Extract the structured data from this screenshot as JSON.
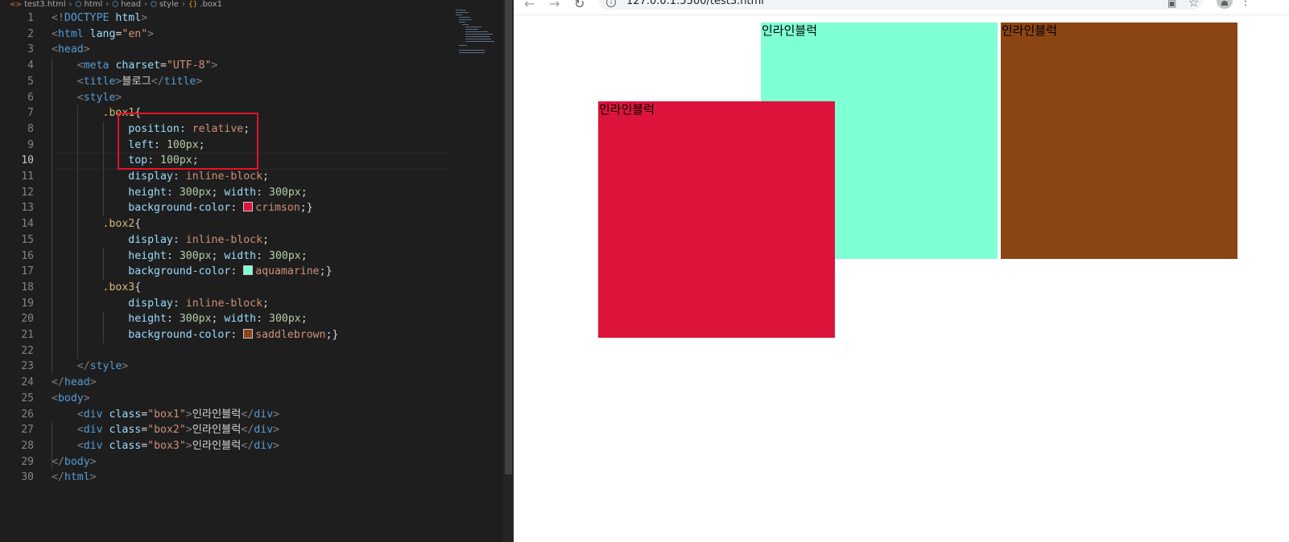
{
  "editor": {
    "breadcrumb": [
      "test3.html",
      "html",
      "head",
      "style",
      ".box1"
    ],
    "lines": [
      {
        "n": "1",
        "tokens": [
          [
            "punc",
            "<!"
          ],
          [
            "tag",
            "DOCTYPE"
          ],
          [
            "txt",
            " "
          ],
          [
            "attr",
            "html"
          ],
          [
            "punc",
            ">"
          ]
        ]
      },
      {
        "n": "2",
        "tokens": [
          [
            "punc",
            "<"
          ],
          [
            "tag",
            "html"
          ],
          [
            "txt",
            " "
          ],
          [
            "attr",
            "lang"
          ],
          [
            "txt",
            "="
          ],
          [
            "str",
            "\"en\""
          ],
          [
            "punc",
            ">"
          ]
        ]
      },
      {
        "n": "3",
        "tokens": [
          [
            "punc",
            "<"
          ],
          [
            "tag",
            "head"
          ],
          [
            "punc",
            ">"
          ]
        ]
      },
      {
        "n": "4",
        "tokens": [
          [
            "txt",
            "    "
          ],
          [
            "punc",
            "<"
          ],
          [
            "tag",
            "meta"
          ],
          [
            "txt",
            " "
          ],
          [
            "attr",
            "charset"
          ],
          [
            "txt",
            "="
          ],
          [
            "str",
            "\"UTF-8\""
          ],
          [
            "punc",
            ">"
          ]
        ]
      },
      {
        "n": "5",
        "tokens": [
          [
            "txt",
            "    "
          ],
          [
            "punc",
            "<"
          ],
          [
            "tag",
            "title"
          ],
          [
            "punc",
            ">"
          ],
          [
            "txt",
            "블로그"
          ],
          [
            "punc",
            "</"
          ],
          [
            "tag",
            "title"
          ],
          [
            "punc",
            ">"
          ]
        ]
      },
      {
        "n": "6",
        "tokens": [
          [
            "txt",
            "    "
          ],
          [
            "punc",
            "<"
          ],
          [
            "tag",
            "style"
          ],
          [
            "punc",
            ">"
          ]
        ]
      },
      {
        "n": "7",
        "tokens": [
          [
            "txt",
            "        "
          ],
          [
            "sel",
            ".box1"
          ],
          [
            "br",
            "{"
          ]
        ]
      },
      {
        "n": "8",
        "tokens": [
          [
            "txt",
            "            "
          ],
          [
            "prop",
            "position"
          ],
          [
            "txt",
            ": "
          ],
          [
            "val",
            "relative"
          ],
          [
            "txt",
            ";"
          ]
        ]
      },
      {
        "n": "9",
        "tokens": [
          [
            "txt",
            "            "
          ],
          [
            "prop",
            "left"
          ],
          [
            "txt",
            ": "
          ],
          [
            "num",
            "100px"
          ],
          [
            "txt",
            ";"
          ]
        ]
      },
      {
        "n": "10",
        "tokens": [
          [
            "txt",
            "            "
          ],
          [
            "prop",
            "top"
          ],
          [
            "txt",
            ": "
          ],
          [
            "num",
            "100px"
          ],
          [
            "txt",
            ";"
          ]
        ]
      },
      {
        "n": "11",
        "tokens": [
          [
            "txt",
            "            "
          ],
          [
            "prop",
            "display"
          ],
          [
            "txt",
            ": "
          ],
          [
            "val",
            "inline-block"
          ],
          [
            "txt",
            ";"
          ]
        ]
      },
      {
        "n": "12",
        "tokens": [
          [
            "txt",
            "            "
          ],
          [
            "prop",
            "height"
          ],
          [
            "txt",
            ": "
          ],
          [
            "num",
            "300px"
          ],
          [
            "txt",
            "; "
          ],
          [
            "prop",
            "width"
          ],
          [
            "txt",
            ": "
          ],
          [
            "num",
            "300px"
          ],
          [
            "txt",
            ";"
          ]
        ]
      },
      {
        "n": "13",
        "tokens": [
          [
            "txt",
            "            "
          ],
          [
            "prop",
            "background-color"
          ],
          [
            "txt",
            ": "
          ],
          [
            "swatch",
            "#dc143c"
          ],
          [
            "val",
            "crimson"
          ],
          [
            "txt",
            ";"
          ],
          [
            "br",
            "}"
          ]
        ]
      },
      {
        "n": "14",
        "tokens": [
          [
            "txt",
            "        "
          ],
          [
            "sel",
            ".box2"
          ],
          [
            "br",
            "{"
          ]
        ]
      },
      {
        "n": "15",
        "tokens": [
          [
            "txt",
            "            "
          ],
          [
            "prop",
            "display"
          ],
          [
            "txt",
            ": "
          ],
          [
            "val",
            "inline-block"
          ],
          [
            "txt",
            ";"
          ]
        ]
      },
      {
        "n": "16",
        "tokens": [
          [
            "txt",
            "            "
          ],
          [
            "prop",
            "height"
          ],
          [
            "txt",
            ": "
          ],
          [
            "num",
            "300px"
          ],
          [
            "txt",
            "; "
          ],
          [
            "prop",
            "width"
          ],
          [
            "txt",
            ": "
          ],
          [
            "num",
            "300px"
          ],
          [
            "txt",
            ";"
          ]
        ]
      },
      {
        "n": "17",
        "tokens": [
          [
            "txt",
            "            "
          ],
          [
            "prop",
            "background-color"
          ],
          [
            "txt",
            ": "
          ],
          [
            "swatch",
            "#7fffd4"
          ],
          [
            "val",
            "aquamarine"
          ],
          [
            "txt",
            ";"
          ],
          [
            "br",
            "}"
          ]
        ]
      },
      {
        "n": "18",
        "tokens": [
          [
            "txt",
            "        "
          ],
          [
            "sel",
            ".box3"
          ],
          [
            "br",
            "{"
          ]
        ]
      },
      {
        "n": "19",
        "tokens": [
          [
            "txt",
            "            "
          ],
          [
            "prop",
            "display"
          ],
          [
            "txt",
            ": "
          ],
          [
            "val",
            "inline-block"
          ],
          [
            "txt",
            ";"
          ]
        ]
      },
      {
        "n": "20",
        "tokens": [
          [
            "txt",
            "            "
          ],
          [
            "prop",
            "height"
          ],
          [
            "txt",
            ": "
          ],
          [
            "num",
            "300px"
          ],
          [
            "txt",
            "; "
          ],
          [
            "prop",
            "width"
          ],
          [
            "txt",
            ": "
          ],
          [
            "num",
            "300px"
          ],
          [
            "txt",
            ";"
          ]
        ]
      },
      {
        "n": "21",
        "tokens": [
          [
            "txt",
            "            "
          ],
          [
            "prop",
            "background-color"
          ],
          [
            "txt",
            ": "
          ],
          [
            "swatch",
            "#8b4513"
          ],
          [
            "val",
            "saddlebrown"
          ],
          [
            "txt",
            ";"
          ],
          [
            "br",
            "}"
          ]
        ]
      },
      {
        "n": "22",
        "tokens": []
      },
      {
        "n": "23",
        "tokens": [
          [
            "txt",
            "    "
          ],
          [
            "punc",
            "</"
          ],
          [
            "tag",
            "style"
          ],
          [
            "punc",
            ">"
          ]
        ]
      },
      {
        "n": "24",
        "tokens": [
          [
            "punc",
            "</"
          ],
          [
            "tag",
            "head"
          ],
          [
            "punc",
            ">"
          ]
        ]
      },
      {
        "n": "25",
        "tokens": [
          [
            "punc",
            "<"
          ],
          [
            "tag",
            "body"
          ],
          [
            "punc",
            ">"
          ]
        ]
      },
      {
        "n": "26",
        "tokens": [
          [
            "txt",
            "    "
          ],
          [
            "punc",
            "<"
          ],
          [
            "tag",
            "div"
          ],
          [
            "txt",
            " "
          ],
          [
            "attr",
            "class"
          ],
          [
            "txt",
            "="
          ],
          [
            "str",
            "\"box1\""
          ],
          [
            "punc",
            ">"
          ],
          [
            "txt",
            "인라인블럭"
          ],
          [
            "punc",
            "</"
          ],
          [
            "tag",
            "div"
          ],
          [
            "punc",
            ">"
          ]
        ]
      },
      {
        "n": "27",
        "tokens": [
          [
            "txt",
            "    "
          ],
          [
            "punc",
            "<"
          ],
          [
            "tag",
            "div"
          ],
          [
            "txt",
            " "
          ],
          [
            "attr",
            "class"
          ],
          [
            "txt",
            "="
          ],
          [
            "str",
            "\"box2\""
          ],
          [
            "punc",
            ">"
          ],
          [
            "txt",
            "인라인블럭"
          ],
          [
            "punc",
            "</"
          ],
          [
            "tag",
            "div"
          ],
          [
            "punc",
            ">"
          ]
        ]
      },
      {
        "n": "28",
        "tokens": [
          [
            "txt",
            "    "
          ],
          [
            "punc",
            "<"
          ],
          [
            "tag",
            "div"
          ],
          [
            "txt",
            " "
          ],
          [
            "attr",
            "class"
          ],
          [
            "txt",
            "="
          ],
          [
            "str",
            "\"box3\""
          ],
          [
            "punc",
            ">"
          ],
          [
            "txt",
            "인라인블럭"
          ],
          [
            "punc",
            "</"
          ],
          [
            "tag",
            "div"
          ],
          [
            "punc",
            ">"
          ]
        ]
      },
      {
        "n": "29",
        "tokens": [
          [
            "punc",
            "</"
          ],
          [
            "tag",
            "body"
          ],
          [
            "punc",
            ">"
          ]
        ]
      },
      {
        "n": "30",
        "tokens": [
          [
            "punc",
            "</"
          ],
          [
            "tag",
            "html"
          ],
          [
            "punc",
            ">"
          ]
        ]
      }
    ],
    "active_line": "10",
    "colors": {
      "background": "#1e1e1e",
      "highlight_box": "#e81123"
    }
  },
  "browser": {
    "url": "127.0.0.1:5500/test3.html",
    "boxes": {
      "box1": {
        "label": "인라인블럭",
        "color": "#dc143c"
      },
      "box2": {
        "label": "인라인블럭",
        "color": "#7fffd4"
      },
      "box3": {
        "label": "인라인블럭",
        "color": "#8b4513"
      }
    },
    "icons": [
      "back-arrow-icon",
      "forward-arrow-icon",
      "reload-icon",
      "info-icon",
      "translate-icon",
      "star-icon",
      "profile-icon",
      "menu-icon"
    ]
  }
}
